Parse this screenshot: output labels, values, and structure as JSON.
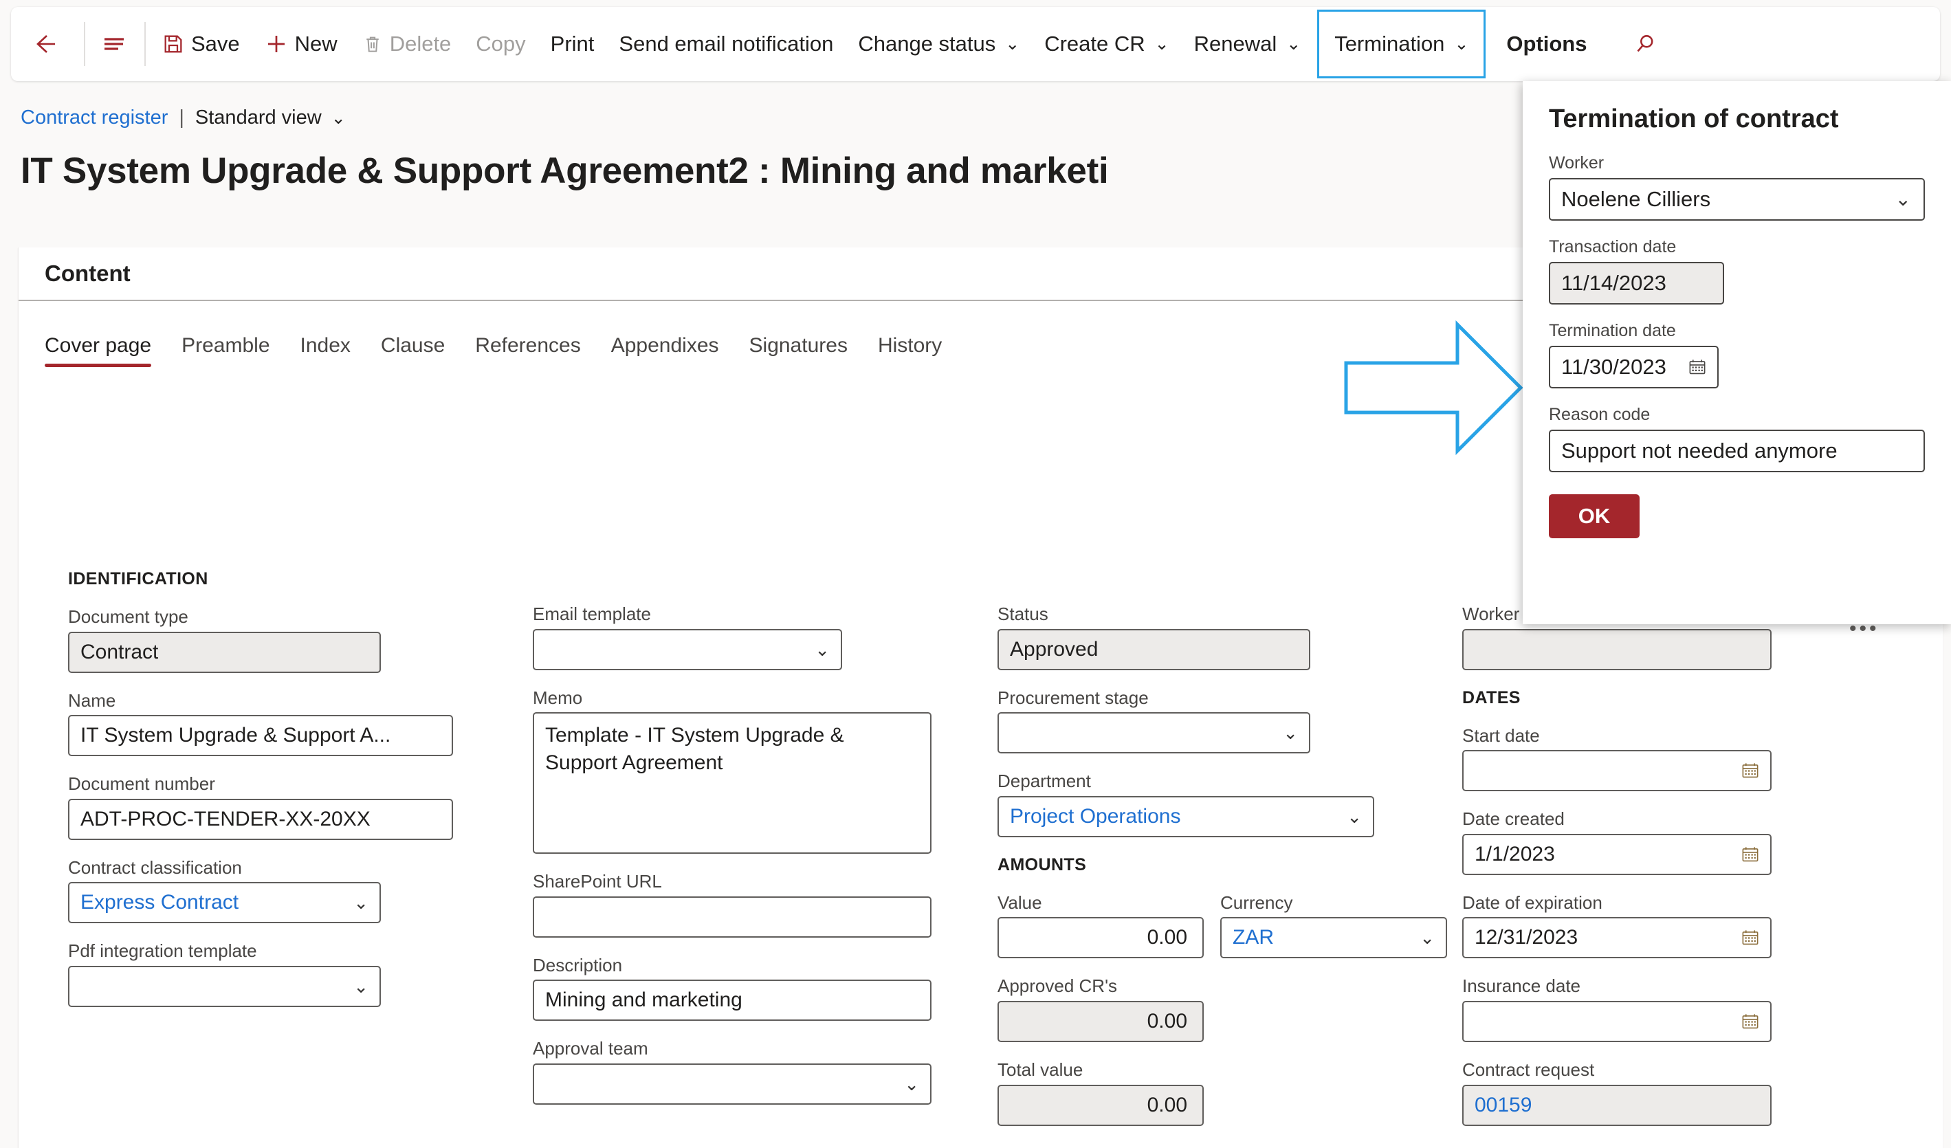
{
  "commandbar": {
    "back_icon": "back-arrow-icon",
    "showlist_icon": "show-list-icon",
    "items": [
      {
        "label": "Save",
        "icon": "save-icon",
        "state": "enabled",
        "chevron": false
      },
      {
        "label": "New",
        "icon": "plus-icon",
        "state": "enabled",
        "chevron": false
      },
      {
        "label": "Delete",
        "icon": "trash-icon",
        "state": "disabled",
        "chevron": false
      },
      {
        "label": "Copy",
        "icon": "",
        "state": "disabled",
        "chevron": false
      },
      {
        "label": "Print",
        "icon": "",
        "state": "enabled",
        "chevron": false
      },
      {
        "label": "Send email notification",
        "icon": "",
        "state": "enabled",
        "chevron": false
      },
      {
        "label": "Change status",
        "icon": "",
        "state": "enabled",
        "chevron": true
      },
      {
        "label": "Create CR",
        "icon": "",
        "state": "enabled",
        "chevron": true
      },
      {
        "label": "Renewal",
        "icon": "",
        "state": "enabled",
        "chevron": true
      },
      {
        "label": "Termination",
        "icon": "",
        "state": "selected",
        "chevron": true
      },
      {
        "label": "Options",
        "icon": "",
        "state": "enabled",
        "chevron": false
      }
    ],
    "search_icon": "search-icon",
    "accent_color": "#a4262c",
    "focus_outline_color": "#29a3e6"
  },
  "breadcrumb": {
    "link": "Contract register",
    "separator": "|",
    "view": "Standard view"
  },
  "page": {
    "title": "IT System Upgrade & Support Agreement2 : Mining and marketi"
  },
  "content": {
    "header": "Content",
    "tabs": [
      {
        "label": "Cover page",
        "active": true
      },
      {
        "label": "Preamble",
        "active": false
      },
      {
        "label": "Index",
        "active": false
      },
      {
        "label": "Clause",
        "active": false
      },
      {
        "label": "References",
        "active": false
      },
      {
        "label": "Appendixes",
        "active": false
      },
      {
        "label": "Signatures",
        "active": false
      },
      {
        "label": "History",
        "active": false
      }
    ],
    "active_tab_underline_color": "#a4262c"
  },
  "form": {
    "sections": {
      "identification": "IDENTIFICATION",
      "amounts": "AMOUNTS",
      "dates": "DATES"
    },
    "document_type": {
      "label": "Document type",
      "value": "Contract",
      "placeholder": ""
    },
    "name": {
      "label": "Name",
      "value": "IT System Upgrade & Support A...",
      "placeholder": ""
    },
    "document_number": {
      "label": "Document number",
      "value": "ADT-PROC-TENDER-XX-20XX",
      "placeholder": ""
    },
    "contract_classification": {
      "label": "Contract classification",
      "value": "Express Contract",
      "placeholder": ""
    },
    "pdf_integration_template": {
      "label": "Pdf integration template",
      "value": "",
      "placeholder": ""
    },
    "email_template": {
      "label": "Email template",
      "value": "",
      "placeholder": ""
    },
    "memo": {
      "label": "Memo",
      "value": "Template - IT System Upgrade & Support Agreement",
      "placeholder": ""
    },
    "sharepoint_url": {
      "label": "SharePoint URL",
      "value": "",
      "placeholder": ""
    },
    "description": {
      "label": "Description",
      "value": "Mining and marketing",
      "placeholder": ""
    },
    "approval_team": {
      "label": "Approval team",
      "value": "",
      "placeholder": ""
    },
    "status": {
      "label": "Status",
      "value": "Approved",
      "placeholder": ""
    },
    "procurement_stage": {
      "label": "Procurement stage",
      "value": "",
      "placeholder": ""
    },
    "department": {
      "label": "Department",
      "value": "Project Operations",
      "placeholder": ""
    },
    "value": {
      "label": "Value",
      "value": "0.00",
      "placeholder": ""
    },
    "currency": {
      "label": "Currency",
      "value": "ZAR",
      "placeholder": ""
    },
    "approved_crs": {
      "label": "Approved CR's",
      "value": "0.00",
      "placeholder": ""
    },
    "total_value": {
      "label": "Total value",
      "value": "0.00",
      "placeholder": ""
    },
    "worker": {
      "label": "Worker",
      "value": "",
      "placeholder": ""
    },
    "start_date": {
      "label": "Start date",
      "value": "",
      "placeholder": ""
    },
    "date_created": {
      "label": "Date created",
      "value": "1/1/2023",
      "placeholder": ""
    },
    "date_of_expiration": {
      "label": "Date of expiration",
      "value": "12/31/2023",
      "placeholder": ""
    },
    "insurance_date": {
      "label": "Insurance date",
      "value": "",
      "placeholder": ""
    },
    "contract_request": {
      "label": "Contract request",
      "value": "00159",
      "placeholder": ""
    }
  },
  "dialog": {
    "title": "Termination of contract",
    "worker": {
      "label": "Worker",
      "value": "Noelene Cilliers",
      "placeholder": ""
    },
    "transaction_date": {
      "label": "Transaction date",
      "value": "11/14/2023",
      "placeholder": ""
    },
    "termination_date": {
      "label": "Termination date",
      "value": "11/30/2023",
      "placeholder": ""
    },
    "reason_code": {
      "label": "Reason code",
      "value": "Support not needed anymore",
      "placeholder": ""
    },
    "ok_label": "OK",
    "ok_color": "#a4262c",
    "overflow_menu": "•••"
  },
  "annotation": {
    "arrow_icon": "right-arrow-annotation",
    "arrow_color": "#29a3e6"
  }
}
